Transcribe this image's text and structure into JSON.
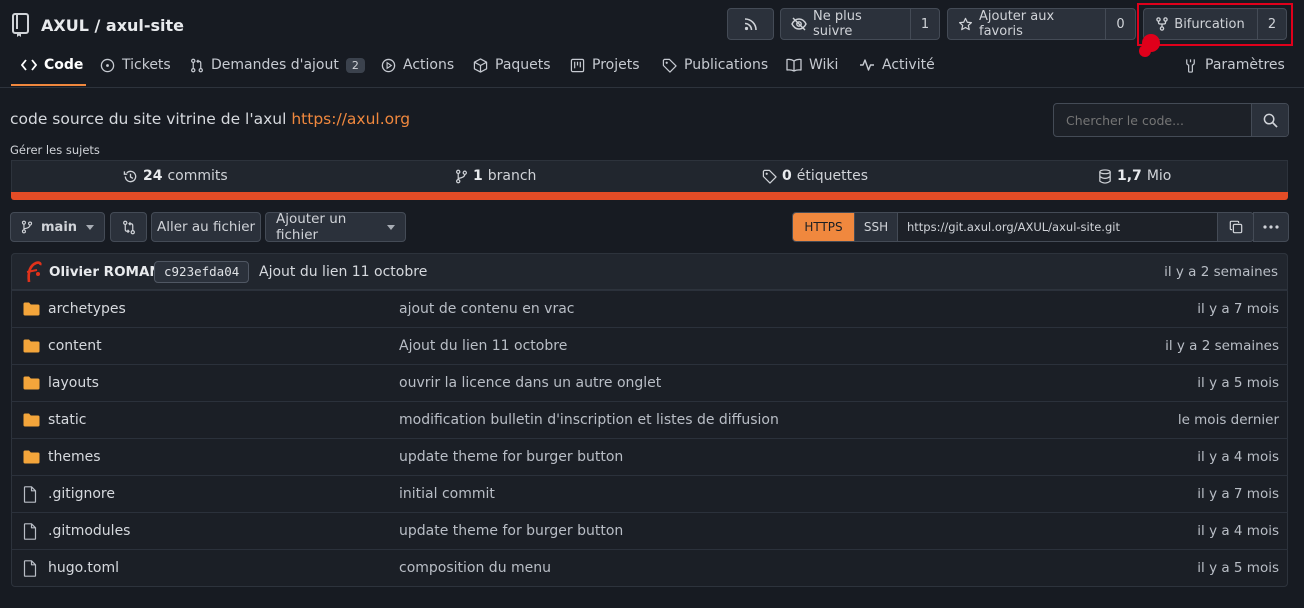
{
  "repo": {
    "owner": "AXUL",
    "separator": " / ",
    "name": "axul-site"
  },
  "header": {
    "unwatch": {
      "label": "Ne plus suivre",
      "count": "1"
    },
    "star": {
      "label": "Ajouter aux favoris",
      "count": "0"
    },
    "fork": {
      "label": "Bifurcation",
      "count": "2"
    }
  },
  "tabs": [
    {
      "label": "Code"
    },
    {
      "label": "Tickets"
    },
    {
      "label": "Demandes d'ajout",
      "count": "2"
    },
    {
      "label": "Actions"
    },
    {
      "label": "Paquets"
    },
    {
      "label": "Projets"
    },
    {
      "label": "Publications"
    },
    {
      "label": "Wiki"
    },
    {
      "label": "Activité"
    }
  ],
  "settings_label": "Paramètres",
  "description": {
    "text": "code source du site vitrine de l'axul",
    "link": "https://axul.org"
  },
  "manage_topics": "Gérer les sujets",
  "search": {
    "placeholder": "Chercher le code..."
  },
  "stats": {
    "commits": {
      "count": "24",
      "label": "commits"
    },
    "branches": {
      "count": "1",
      "label": "branch"
    },
    "tags": {
      "count": "0",
      "label": "étiquettes"
    },
    "size": {
      "count": "1,7",
      "label": "Mio"
    }
  },
  "language_bar_color": "#e34c26",
  "toolbar": {
    "branch": "main",
    "go_to_file": "Aller au fichier",
    "add_file": "Ajouter un fichier",
    "https": "HTTPS",
    "ssh": "SSH",
    "clone_url": "https://git.axul.org/AXUL/axul-site.git"
  },
  "last_commit": {
    "author": "Olivier ROMAN",
    "sha": "c923efda04",
    "message": "Ajout du lien 11 octobre",
    "time": "il y a 2 semaines"
  },
  "files": [
    {
      "name": "archetypes",
      "type": "folder",
      "message": "ajout de contenu en vrac",
      "time": "il y a 7 mois"
    },
    {
      "name": "content",
      "type": "folder",
      "message": "Ajout du lien 11 octobre",
      "time": "il y a 2 semaines"
    },
    {
      "name": "layouts",
      "type": "folder",
      "message": "ouvrir la licence dans un autre onglet",
      "time": "il y a 5 mois"
    },
    {
      "name": "static",
      "type": "folder",
      "message": "modification bulletin d'inscription et listes de diffusion",
      "time": "le mois dernier"
    },
    {
      "name": "themes",
      "type": "folder",
      "message": "update theme for burger button",
      "time": "il y a 4 mois"
    },
    {
      "name": ".gitignore",
      "type": "file",
      "message": "initial commit",
      "time": "il y a 7 mois"
    },
    {
      "name": ".gitmodules",
      "type": "file",
      "message": "update theme for burger button",
      "time": "il y a 4 mois"
    },
    {
      "name": "hugo.toml",
      "type": "file",
      "message": "composition du menu",
      "time": "il y a 5 mois"
    }
  ],
  "colors": {
    "accent": "#f0883e",
    "highlight": "#e0001b",
    "folder": "#f3a53b"
  }
}
